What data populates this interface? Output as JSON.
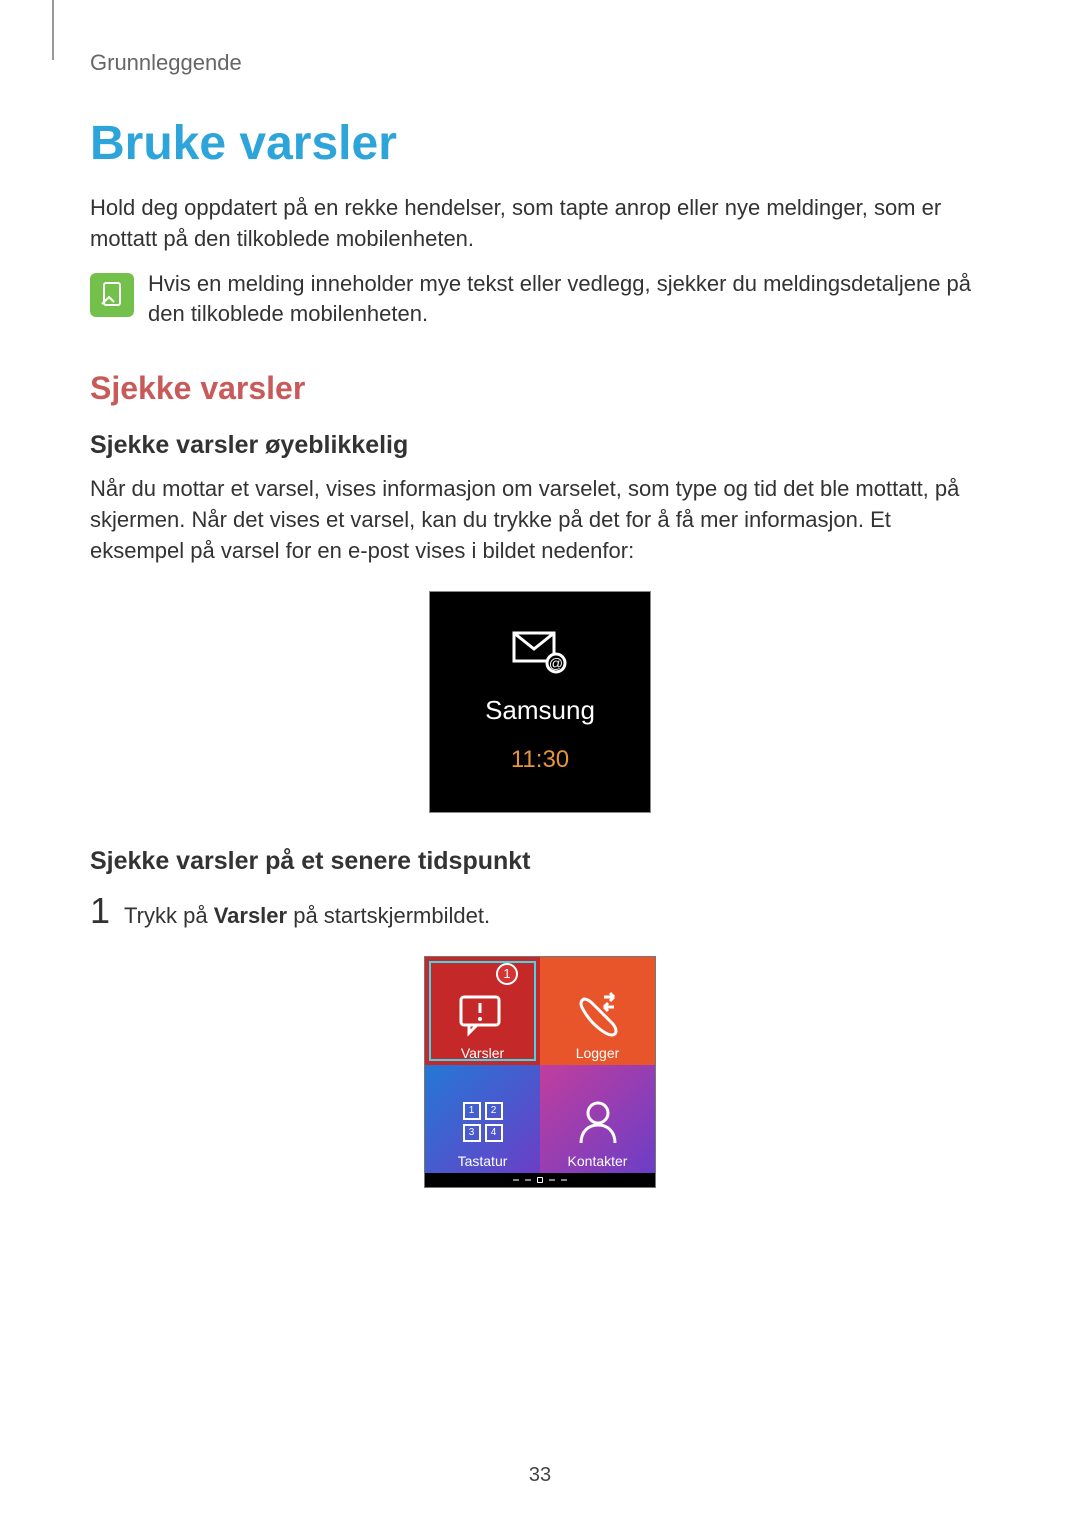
{
  "header": "Grunnleggende",
  "main_title": "Bruke varsler",
  "intro": "Hold deg oppdatert på en rekke hendelser, som tapte anrop eller nye meldinger, som er mottatt på den tilkoblede mobilenheten.",
  "note": "Hvis en melding inneholder mye tekst eller vedlegg, sjekker du meldingsdetaljene på den tilkoblede mobilenheten.",
  "section_title": "Sjekke varsler",
  "sub1_title": "Sjekke varsler øyeblikkelig",
  "sub1_body": "Når du mottar et varsel, vises informasjon om varselet, som type og tid det ble mottatt, på skjermen. Når det vises et varsel, kan du trykke på det for å få mer informasjon. Et eksempel på varsel for en e-post vises i bildet nedenfor:",
  "notification": {
    "sender": "Samsung",
    "time": "11:30"
  },
  "sub2_title": "Sjekke varsler på et senere tidspunkt",
  "step1_num": "1",
  "step1_prefix": "Trykk på ",
  "step1_bold": "Varsler",
  "step1_suffix": " på startskjermbildet.",
  "tiles": {
    "varsler": "Varsler",
    "logger": "Logger",
    "tastatur": "Tastatur",
    "kontakter": "Kontakter",
    "badge": "1",
    "keypad": [
      "1",
      "2",
      "3",
      "4"
    ]
  },
  "page_number": "33"
}
